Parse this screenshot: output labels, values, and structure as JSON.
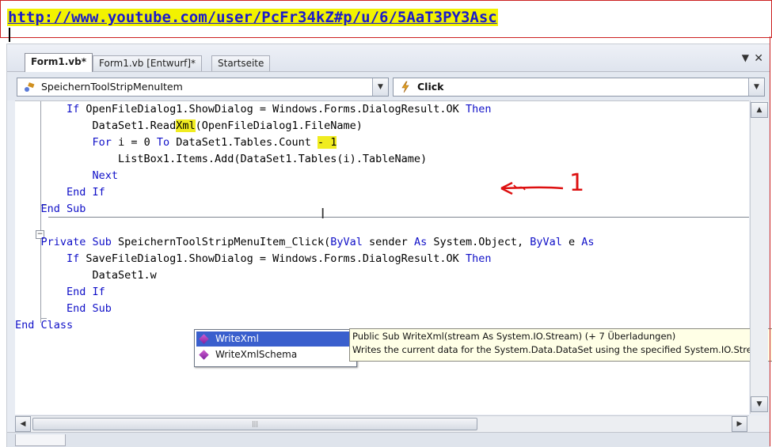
{
  "banner": {
    "url": "http://www.youtube.com/user/PcFr34kZ#p/u/6/5AaT3PY3Asc"
  },
  "tabs": [
    {
      "label": "Form1.vb*",
      "active": true
    },
    {
      "label": "Form1.vb [Entwurf]*",
      "active": false
    },
    {
      "label": "Startseite",
      "active": false
    }
  ],
  "nav": {
    "object_combo": "SpeichernToolStripMenuItem",
    "event_combo": "Click"
  },
  "code_lines": [
    "        If OpenFileDialog1.ShowDialog = Windows.Forms.DialogResult.OK Then",
    "            DataSet1.ReadXml(OpenFileDialog1.FileName)",
    "            For i = 0 To DataSet1.Tables.Count - 1",
    "                ListBox1.Items.Add(DataSet1.Tables(i).TableName)",
    "            Next",
    "        End If",
    "    End Sub",
    "",
    "    Private Sub SpeichernToolStripMenuItem_Click(ByVal sender As System.Object, ByVal e As",
    "        If SaveFileDialog1.ShowDialog = Windows.Forms.DialogResult.OK Then",
    "            DataSet1.w",
    "        End If",
    "        End Sub",
    "End Class"
  ],
  "annotation": {
    "label": "1",
    "color": "#dd1010"
  },
  "intellisense": {
    "items": [
      {
        "label": "WriteXml",
        "selected": true
      },
      {
        "label": "WriteXmlSchema",
        "selected": false
      }
    ],
    "tooltip_line1": "Public Sub WriteXml(stream As System.IO.Stream) (+ 7 Überladungen)",
    "tooltip_line2": "Writes the current data for the System.Data.DataSet using the specified System.IO.Stream"
  },
  "colors": {
    "keyword": "#1010c8",
    "highlight": "#f0ec20",
    "url": "#1a1acc",
    "selection": "#3a5fcd"
  },
  "icons": {
    "object_combo": "class-member-icon",
    "event_combo": "lightning-event-icon",
    "intellisense_item": "method-icon"
  }
}
